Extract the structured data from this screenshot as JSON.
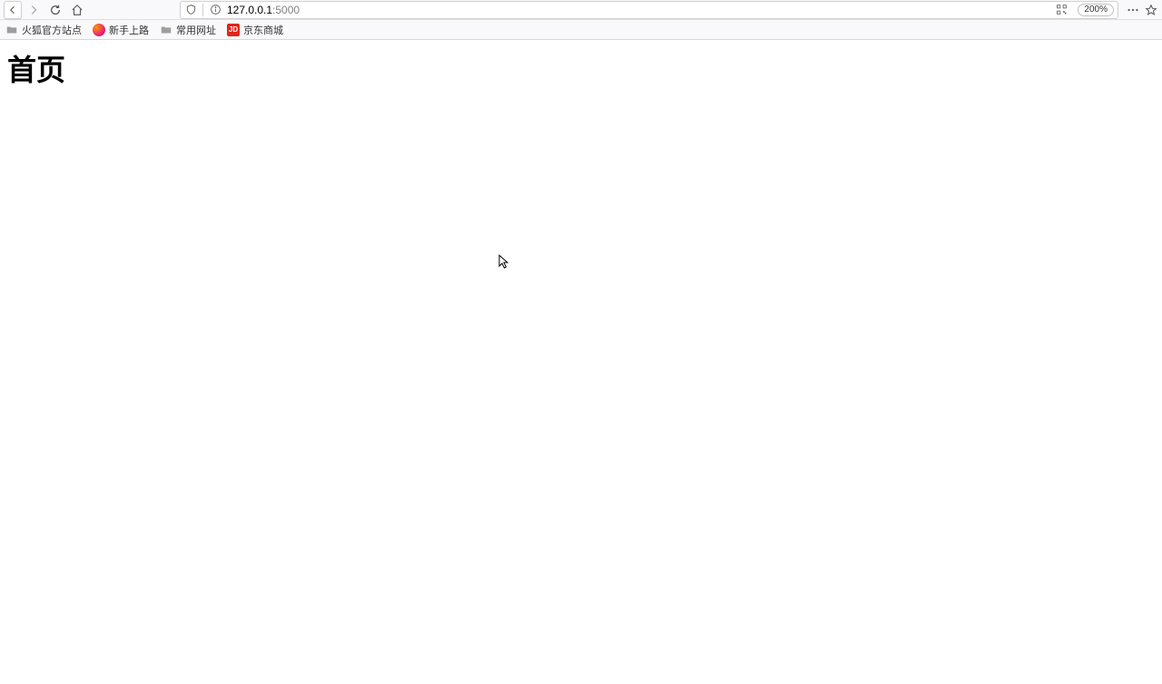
{
  "nav": {
    "url_host": "127.0.0.1",
    "url_port": ":5000",
    "zoom": "200%"
  },
  "bookmarks": [
    {
      "type": "folder",
      "label": "火狐官方站点"
    },
    {
      "type": "firefox",
      "label": "新手上路"
    },
    {
      "type": "folder",
      "label": "常用网址"
    },
    {
      "type": "jd",
      "label": "京东商城"
    }
  ],
  "page": {
    "heading": "首页"
  }
}
